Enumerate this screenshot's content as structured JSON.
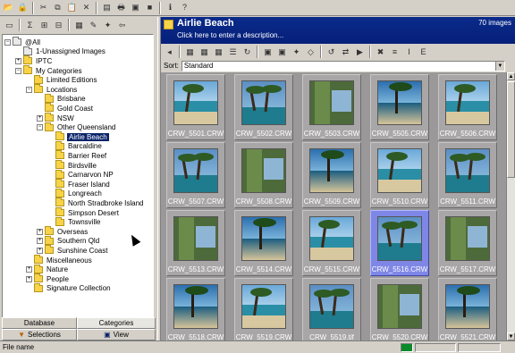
{
  "main_toolbar": {
    "buttons": [
      {
        "name": "open",
        "glyph": "📂"
      },
      {
        "name": "lock",
        "glyph": "🔒"
      },
      {
        "name": "cut",
        "glyph": "✂"
      },
      {
        "name": "copy",
        "glyph": "⧉"
      },
      {
        "name": "paste",
        "glyph": "📋"
      },
      {
        "name": "delete",
        "glyph": "✕"
      },
      {
        "name": "catalog",
        "glyph": "▤"
      },
      {
        "name": "print",
        "glyph": "🖶"
      },
      {
        "name": "camera",
        "glyph": "▣"
      },
      {
        "name": "stop",
        "glyph": "■"
      },
      {
        "name": "info",
        "glyph": "ℹ"
      },
      {
        "name": "help",
        "glyph": "?"
      }
    ]
  },
  "left_toolbar": {
    "buttons": [
      {
        "name": "panel",
        "glyph": "▭"
      },
      {
        "name": "sum",
        "glyph": "Σ"
      },
      {
        "name": "tree-expand",
        "glyph": "⊞"
      },
      {
        "name": "tree-collapse",
        "glyph": "⊟"
      },
      {
        "name": "new-category",
        "glyph": "▦"
      },
      {
        "name": "edit-category",
        "glyph": "✎"
      },
      {
        "name": "magic",
        "glyph": "✦"
      },
      {
        "name": "back",
        "glyph": "⇦"
      }
    ]
  },
  "tree": {
    "nodes": [
      {
        "label": "@All",
        "level": 0,
        "exp": "−",
        "icon": "special"
      },
      {
        "label": "1-Unassigned Images",
        "level": 1,
        "exp": "",
        "icon": "special"
      },
      {
        "label": "IPTC",
        "level": 1,
        "exp": "+",
        "icon": "folder"
      },
      {
        "label": "My Categories",
        "level": 1,
        "exp": "−",
        "icon": "folder"
      },
      {
        "label": "Limited Editions",
        "level": 2,
        "exp": "",
        "icon": "folder"
      },
      {
        "label": "Locations",
        "level": 2,
        "exp": "−",
        "icon": "folder"
      },
      {
        "label": "Brisbane",
        "level": 3,
        "exp": "",
        "icon": "folder"
      },
      {
        "label": "Gold Coast",
        "level": 3,
        "exp": "",
        "icon": "folder"
      },
      {
        "label": "NSW",
        "level": 3,
        "exp": "+",
        "icon": "folder"
      },
      {
        "label": "Other Queensland",
        "level": 3,
        "exp": "−",
        "icon": "folder"
      },
      {
        "label": "Airlie Beach",
        "level": 4,
        "exp": "",
        "icon": "folder",
        "selected": true
      },
      {
        "label": "Barcaldine",
        "level": 4,
        "exp": "",
        "icon": "folder"
      },
      {
        "label": "Barrier Reef",
        "level": 4,
        "exp": "",
        "icon": "folder"
      },
      {
        "label": "Birdsville",
        "level": 4,
        "exp": "",
        "icon": "folder"
      },
      {
        "label": "Carnarvon NP",
        "level": 4,
        "exp": "",
        "icon": "folder"
      },
      {
        "label": "Fraser Island",
        "level": 4,
        "exp": "",
        "icon": "folder"
      },
      {
        "label": "Longreach",
        "level": 4,
        "exp": "",
        "icon": "folder"
      },
      {
        "label": "North Stradbroke Island",
        "level": 4,
        "exp": "",
        "icon": "folder"
      },
      {
        "label": "Simpson Desert",
        "level": 4,
        "exp": "",
        "icon": "folder"
      },
      {
        "label": "Townsville",
        "level": 4,
        "exp": "",
        "icon": "folder"
      },
      {
        "label": "Overseas",
        "level": 3,
        "exp": "+",
        "icon": "folder"
      },
      {
        "label": "Southern Qld",
        "level": 3,
        "exp": "+",
        "icon": "folder"
      },
      {
        "label": "Sunshine Coast",
        "level": 3,
        "exp": "+",
        "icon": "folder"
      },
      {
        "label": "Miscellaneous",
        "level": 2,
        "exp": "",
        "icon": "folder"
      },
      {
        "label": "Nature",
        "level": 2,
        "exp": "+",
        "icon": "folder"
      },
      {
        "label": "People",
        "level": 2,
        "exp": "+",
        "icon": "folder"
      },
      {
        "label": "Signature Collection",
        "level": 2,
        "exp": "",
        "icon": "folder"
      }
    ]
  },
  "bottom_tabs": {
    "database": "Database",
    "categories": "Categories",
    "selections": "Selections",
    "view": "View"
  },
  "header": {
    "title": "Airlie Beach",
    "description": "Click here to enter a description...",
    "count": "70 images"
  },
  "right_toolbar": {
    "buttons": [
      {
        "name": "view-back",
        "glyph": "◂"
      },
      {
        "name": "view-grid-small",
        "glyph": "▦"
      },
      {
        "name": "view-grid-medium",
        "glyph": "▦"
      },
      {
        "name": "view-grid-large",
        "glyph": "▦"
      },
      {
        "name": "view-list",
        "glyph": "☰"
      },
      {
        "name": "refresh",
        "glyph": "↻"
      },
      {
        "name": "image-edit",
        "glyph": "▣"
      },
      {
        "name": "image-props",
        "glyph": "▣"
      },
      {
        "name": "magic-wand",
        "glyph": "✦"
      },
      {
        "name": "tag",
        "glyph": "◇"
      },
      {
        "name": "rotate",
        "glyph": "↺"
      },
      {
        "name": "move",
        "glyph": "⇄"
      },
      {
        "name": "slideshow",
        "glyph": "▶"
      },
      {
        "name": "delete",
        "glyph": "✖"
      },
      {
        "name": "details",
        "glyph": "≡"
      },
      {
        "name": "iptc",
        "glyph": "I"
      },
      {
        "name": "exif",
        "glyph": "E"
      }
    ]
  },
  "sort": {
    "label": "Sort:",
    "value": "Standard"
  },
  "thumbnails": [
    {
      "caption": "CRW_5501.CRW",
      "selected": false
    },
    {
      "caption": "CRW_5502.CRW",
      "selected": false
    },
    {
      "caption": "CRW_5503.CRW",
      "selected": false
    },
    {
      "caption": "CRW_5505.CRW",
      "selected": false
    },
    {
      "caption": "CRW_5506.CRW",
      "selected": false
    },
    {
      "caption": "CRW_5507.CRW",
      "selected": false
    },
    {
      "caption": "CRW_5508.CRW",
      "selected": false
    },
    {
      "caption": "CRW_5509.CRW",
      "selected": false
    },
    {
      "caption": "CRW_5510.CRW",
      "selected": false
    },
    {
      "caption": "CRW_5511.CRW",
      "selected": false
    },
    {
      "caption": "CRW_5513.CRW",
      "selected": false
    },
    {
      "caption": "CRW_5514.CRW",
      "selected": false
    },
    {
      "caption": "CRW_5515.CRW",
      "selected": false
    },
    {
      "caption": "CRW_5516.CRW",
      "selected": true
    },
    {
      "caption": "CRW_5517.CRW",
      "selected": false
    },
    {
      "caption": "CRW_5518.CRW",
      "selected": false
    },
    {
      "caption": "CRW_5519.CRW",
      "selected": false
    },
    {
      "caption": "CRW_5519.tif",
      "selected": false
    },
    {
      "caption": "CRW_5520.CRW",
      "selected": false
    },
    {
      "caption": "CRW_5521.CRW",
      "selected": false
    }
  ],
  "status": {
    "text": "File name"
  },
  "colors": {
    "header_bg": "#0a2a8a",
    "selection": "#0a246a",
    "thumb_selected": "#7f87e6"
  }
}
